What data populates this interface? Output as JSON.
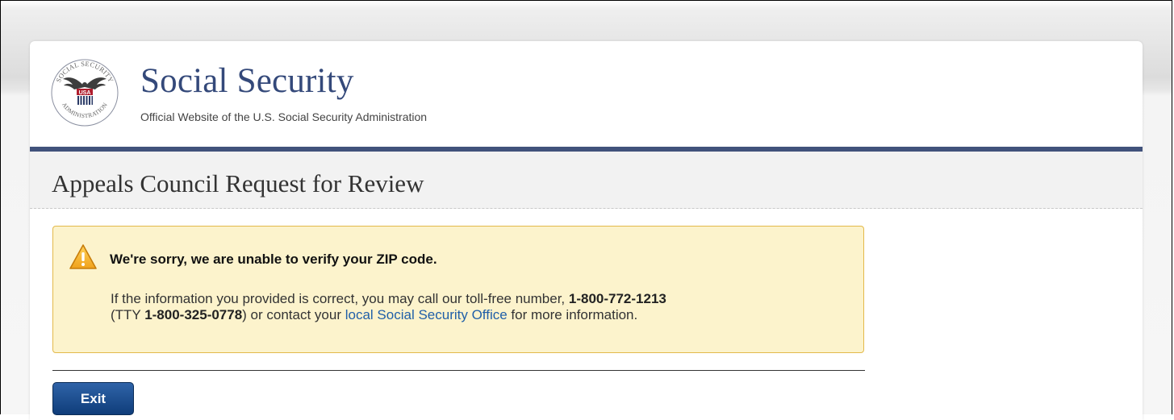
{
  "header": {
    "title": "Social Security",
    "subtitle": "Official Website of the U.S. Social Security Administration",
    "logo": {
      "icon": "ssa-seal-icon",
      "seal_top_text": "SOCIAL SECURITY",
      "seal_bottom_text": "ADMINISTRATION",
      "seal_center_text": "USA"
    }
  },
  "page": {
    "title": "Appeals Council Request for Review"
  },
  "alert": {
    "icon": "warning-icon",
    "heading": "We're sorry, we are unable to verify your ZIP code.",
    "line1_text": "If the information you provided is correct, you may call our toll-free number, ",
    "phone": "1-800-772-1213",
    "line2_prefix": "(TTY ",
    "tty_phone": "1-800-325-0778",
    "line2_middle": ") or contact your ",
    "link_text": "local Social Security Office",
    "line2_suffix": " for more information."
  },
  "actions": {
    "exit_label": "Exit"
  },
  "colors": {
    "brand": "#34497a",
    "nav_bar": "#41527b",
    "alert_bg": "#fcf3cc",
    "alert_border": "#e3b94a",
    "link": "#205fa8",
    "button": "#1e4e8f"
  }
}
